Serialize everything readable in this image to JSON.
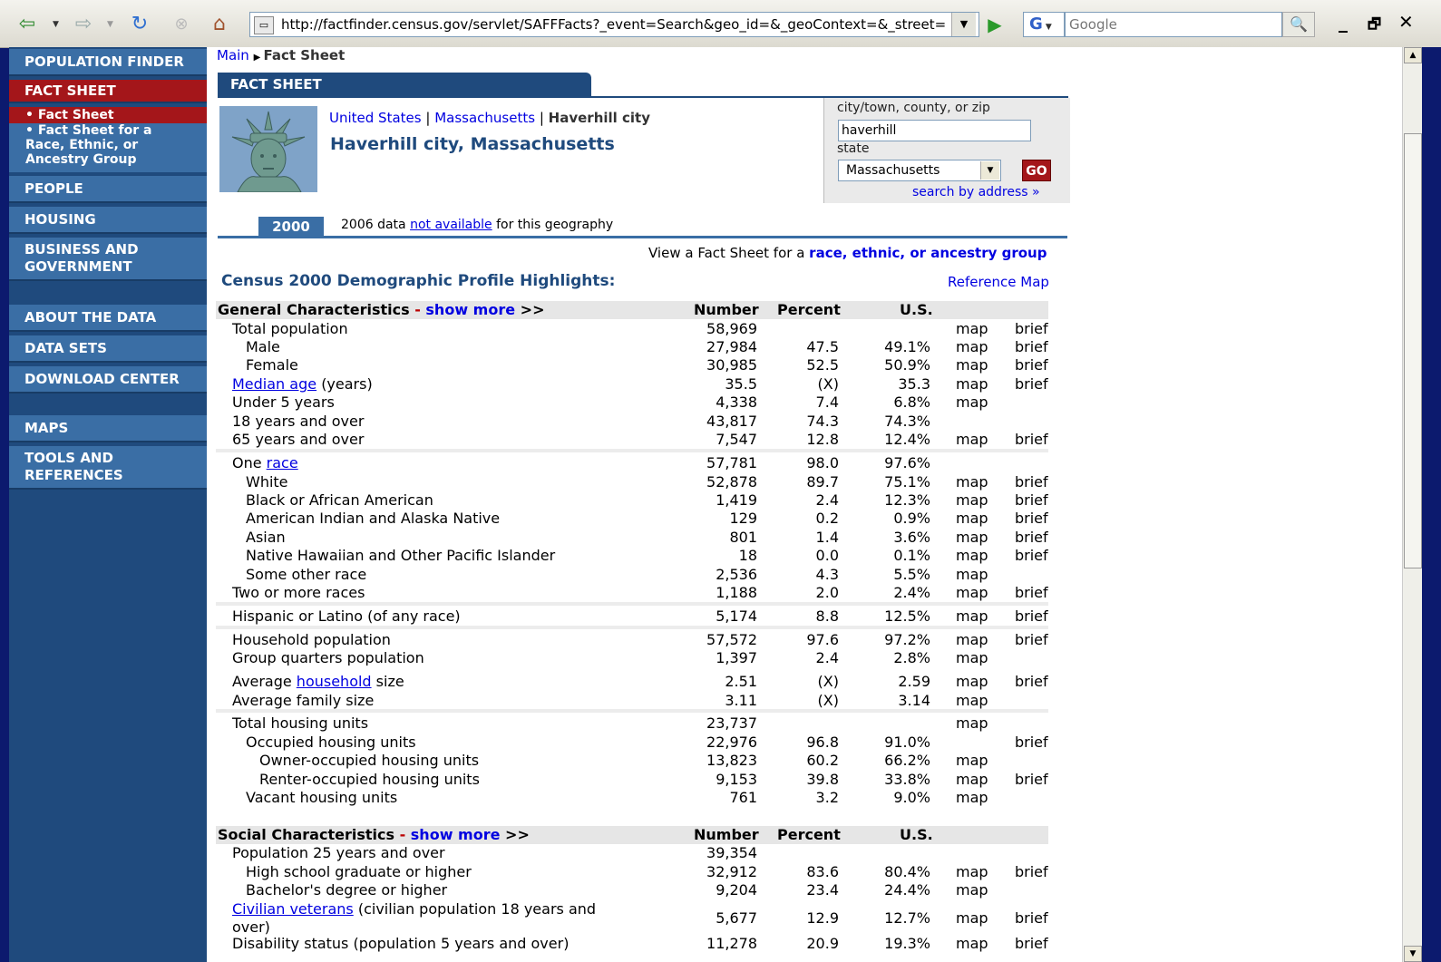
{
  "browser": {
    "address": "http://factfinder.census.gov/servlet/SAFFFacts?_event=Search&geo_id=&_geoContext=&_street=",
    "search_engine_letter": "G",
    "search_placeholder": "Google",
    "window_min": "_",
    "window_restore": "🗗",
    "window_close": "✕"
  },
  "nav": {
    "items": [
      {
        "label": "POPULATION FINDER"
      },
      {
        "label": "FACT SHEET"
      },
      {
        "label": "PEOPLE"
      },
      {
        "label": "HOUSING"
      },
      {
        "label": "BUSINESS AND GOVERNMENT"
      },
      {
        "label": "ABOUT THE DATA"
      },
      {
        "label": "DATA SETS"
      },
      {
        "label": "DOWNLOAD CENTER"
      },
      {
        "label": "MAPS"
      },
      {
        "label": "TOOLS AND REFERENCES"
      }
    ],
    "sub": [
      {
        "label": "• Fact Sheet"
      },
      {
        "label": "• Fact Sheet for a Race, Ethnic, or Ancestry Group"
      }
    ]
  },
  "breadcrumb": {
    "home": "Main",
    "current": "Fact Sheet"
  },
  "tab_title": "FACT SHEET",
  "geo": {
    "crumb1": "United States",
    "crumb2": "Massachusetts",
    "crumb3": "Haverhill city",
    "sep": "|",
    "title": "Haverhill city, Massachusetts"
  },
  "search": {
    "label_city": "city/town, county, or zip",
    "city_value": "haverhill",
    "label_state": "state",
    "state_value": "Massachusetts",
    "go": "GO",
    "by_address": "search by address »"
  },
  "year": {
    "tab": "2000",
    "note_pre": "2006 data",
    "note_link": "not available",
    "note_post": "for this geography"
  },
  "view_fact_sheet": {
    "pre": "View a Fact Sheet for a",
    "link": "race, ethnic, or ancestry group"
  },
  "section_title": "Census 2000 Demographic Profile Highlights:",
  "reference_map": "Reference Map",
  "columns": {
    "number": "Number",
    "percent": "Percent",
    "us": "U.S."
  },
  "general": {
    "title": "General Characteristics",
    "dash": "-",
    "show_more": "show more",
    "arrows": ">>",
    "rows": [
      {
        "label": "Total population",
        "number": "58,969",
        "percent": "",
        "us": "",
        "map": "map",
        "brief": "brief"
      },
      {
        "label": "Male",
        "number": "27,984",
        "percent": "47.5",
        "us": "49.1%",
        "map": "map",
        "brief": "brief"
      },
      {
        "label": "Female",
        "number": "30,985",
        "percent": "52.5",
        "us": "50.9%",
        "map": "map",
        "brief": "brief"
      },
      {
        "label_link": "Median age",
        "label": "(years)",
        "number": "35.5",
        "percent": "(X)",
        "us": "35.3",
        "map": "map",
        "brief": "brief"
      },
      {
        "label": "Under 5 years",
        "number": "4,338",
        "percent": "7.4",
        "us": "6.8%",
        "map": "map",
        "brief": ""
      },
      {
        "label": "18 years and over",
        "number": "43,817",
        "percent": "74.3",
        "us": "74.3%",
        "map": "",
        "brief": ""
      },
      {
        "label": "65 years and over",
        "number": "7,547",
        "percent": "12.8",
        "us": "12.4%",
        "map": "map",
        "brief": "brief"
      },
      {
        "label_pre": "One",
        "label_link": "race",
        "number": "57,781",
        "percent": "98.0",
        "us": "97.6%",
        "map": "",
        "brief": ""
      },
      {
        "label": "White",
        "number": "52,878",
        "percent": "89.7",
        "us": "75.1%",
        "map": "map",
        "brief": "brief"
      },
      {
        "label": "Black or African American",
        "number": "1,419",
        "percent": "2.4",
        "us": "12.3%",
        "map": "map",
        "brief": "brief"
      },
      {
        "label": "American Indian and Alaska Native",
        "number": "129",
        "percent": "0.2",
        "us": "0.9%",
        "map": "map",
        "brief": "brief"
      },
      {
        "label": "Asian",
        "number": "801",
        "percent": "1.4",
        "us": "3.6%",
        "map": "map",
        "brief": "brief"
      },
      {
        "label": "Native Hawaiian and Other Pacific Islander",
        "number": "18",
        "percent": "0.0",
        "us": "0.1%",
        "map": "map",
        "brief": "brief"
      },
      {
        "label": "Some other race",
        "number": "2,536",
        "percent": "4.3",
        "us": "5.5%",
        "map": "map",
        "brief": ""
      },
      {
        "label": "Two or more races",
        "number": "1,188",
        "percent": "2.0",
        "us": "2.4%",
        "map": "map",
        "brief": "brief"
      },
      {
        "label": "Hispanic or Latino (of any race)",
        "number": "5,174",
        "percent": "8.8",
        "us": "12.5%",
        "map": "map",
        "brief": "brief"
      },
      {
        "label": "Household population",
        "number": "57,572",
        "percent": "97.6",
        "us": "97.2%",
        "map": "map",
        "brief": "brief"
      },
      {
        "label": "Group quarters population",
        "number": "1,397",
        "percent": "2.4",
        "us": "2.8%",
        "map": "map",
        "brief": ""
      },
      {
        "label_pre": "Average",
        "label_link": "household",
        "label": "size",
        "number": "2.51",
        "percent": "(X)",
        "us": "2.59",
        "map": "map",
        "brief": "brief"
      },
      {
        "label": "Average family size",
        "number": "3.11",
        "percent": "(X)",
        "us": "3.14",
        "map": "map",
        "brief": ""
      },
      {
        "label": "Total housing units",
        "number": "23,737",
        "percent": "",
        "us": "",
        "map": "map",
        "brief": ""
      },
      {
        "label": "Occupied housing units",
        "number": "22,976",
        "percent": "96.8",
        "us": "91.0%",
        "map": "",
        "brief": "brief"
      },
      {
        "label": "Owner-occupied housing units",
        "number": "13,823",
        "percent": "60.2",
        "us": "66.2%",
        "map": "map",
        "brief": ""
      },
      {
        "label": "Renter-occupied housing units",
        "number": "9,153",
        "percent": "39.8",
        "us": "33.8%",
        "map": "map",
        "brief": "brief"
      },
      {
        "label": "Vacant housing units",
        "number": "761",
        "percent": "3.2",
        "us": "9.0%",
        "map": "map",
        "brief": ""
      }
    ]
  },
  "social": {
    "title": "Social Characteristics",
    "dash": "-",
    "show_more": "show more",
    "arrows": ">>",
    "rows": [
      {
        "label": "Population 25 years and over",
        "number": "39,354",
        "percent": "",
        "us": "",
        "map": "",
        "brief": ""
      },
      {
        "label": "High school graduate or higher",
        "number": "32,912",
        "percent": "83.6",
        "us": "80.4%",
        "map": "map",
        "brief": "brief"
      },
      {
        "label": "Bachelor's degree or higher",
        "number": "9,204",
        "percent": "23.4",
        "us": "24.4%",
        "map": "map",
        "brief": ""
      },
      {
        "label_link": "Civilian veterans",
        "label": "(civilian population 18 years and",
        "label2": "over)",
        "number": "5,677",
        "percent": "12.9",
        "us": "12.7%",
        "map": "map",
        "brief": "brief"
      },
      {
        "label": "Disability status (population 5 years and over)",
        "number": "11,278",
        "percent": "20.9",
        "us": "19.3%",
        "map": "map",
        "brief": "brief"
      }
    ]
  }
}
